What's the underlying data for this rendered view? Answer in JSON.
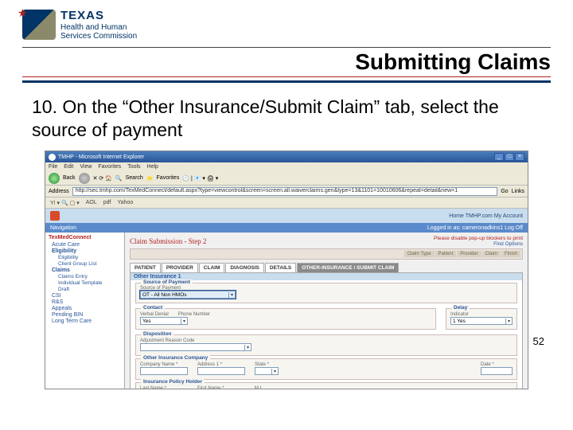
{
  "logo": {
    "line1": "TEXAS",
    "line2": "Health and Human",
    "line3": "Services Commission"
  },
  "slide": {
    "title": "Submitting Claims",
    "instruction": "10. On the “Other Insurance/Submit Claim” tab,  select the source of payment",
    "page_num": "52"
  },
  "ie": {
    "title": "TMHP - Microsoft Internet Explorer",
    "menu": [
      "File",
      "Edit",
      "View",
      "Favorites",
      "Tools",
      "Help"
    ],
    "back": "Back",
    "search": "Search",
    "favs": "Favorites",
    "address_label": "Address",
    "address": "http://sec.tmhp.com/TexMedConnect/default.aspx?type=viewcontrol&screen=screen.all.waiverclaims.gen&type=13&1101=10010606&repeat=detail&new=1",
    "go": "Go",
    "links": "Links",
    "extras": [
      "AOL",
      "pdf",
      "Yahoo"
    ]
  },
  "app": {
    "top_links": "Home  TMHP.com  My Account",
    "logged": "Logged in as: cameronadkins1 Log Off",
    "nav_title": "Navigation",
    "find": "Find Options",
    "sidebar": {
      "root": "TexMedConnect",
      "acute": "Acute Care",
      "groups": [
        "Eligibility",
        "Claims",
        "CSI",
        "R&S",
        "Appeals",
        "Pending BIN",
        "Long Term Care"
      ],
      "elig_sub": [
        "Eligibility",
        "Client Group List"
      ],
      "claim_sub": [
        "Claims Entry",
        "Individual Template",
        "Draft"
      ]
    },
    "crumb": "Claim Submission - Step 2",
    "warn": "Please disable pop-up blockers to print",
    "step_btns": [
      "Claim Type",
      "Patient",
      "Provider",
      "Claim",
      "Finish"
    ],
    "tabs": [
      "PATIENT",
      "PROVIDER",
      "CLAIM",
      "DIAGNOSIS",
      "DETAILS",
      "OTHER-INSURANCE / SUBMIT CLAIM"
    ],
    "panel_title": "Other Insurance 1",
    "source": {
      "legend": "Source of Payment",
      "lbl": "Source of Payment",
      "val": "OT - All Non HMOs"
    },
    "contact": {
      "legend": "Contact",
      "lbl1": "Verbal Denial",
      "lbl2": "Phone Number",
      "val": "Yes"
    },
    "delay": {
      "legend": "Delay",
      "lbl": "Indicator",
      "val": "1 Yes"
    },
    "dispo": {
      "legend": "Disposition",
      "lbl": "Adjustment Reason Code"
    },
    "oic": {
      "legend": "Other Insurance Company",
      "c1": "Company Name *",
      "c2": "Address 1 *",
      "c3": "State *",
      "c4": "Date *"
    },
    "policy": {
      "legend": "Insurance Policy Holder",
      "c1": "Last Name *",
      "c2": "First Name *",
      "c3": "M I"
    }
  }
}
